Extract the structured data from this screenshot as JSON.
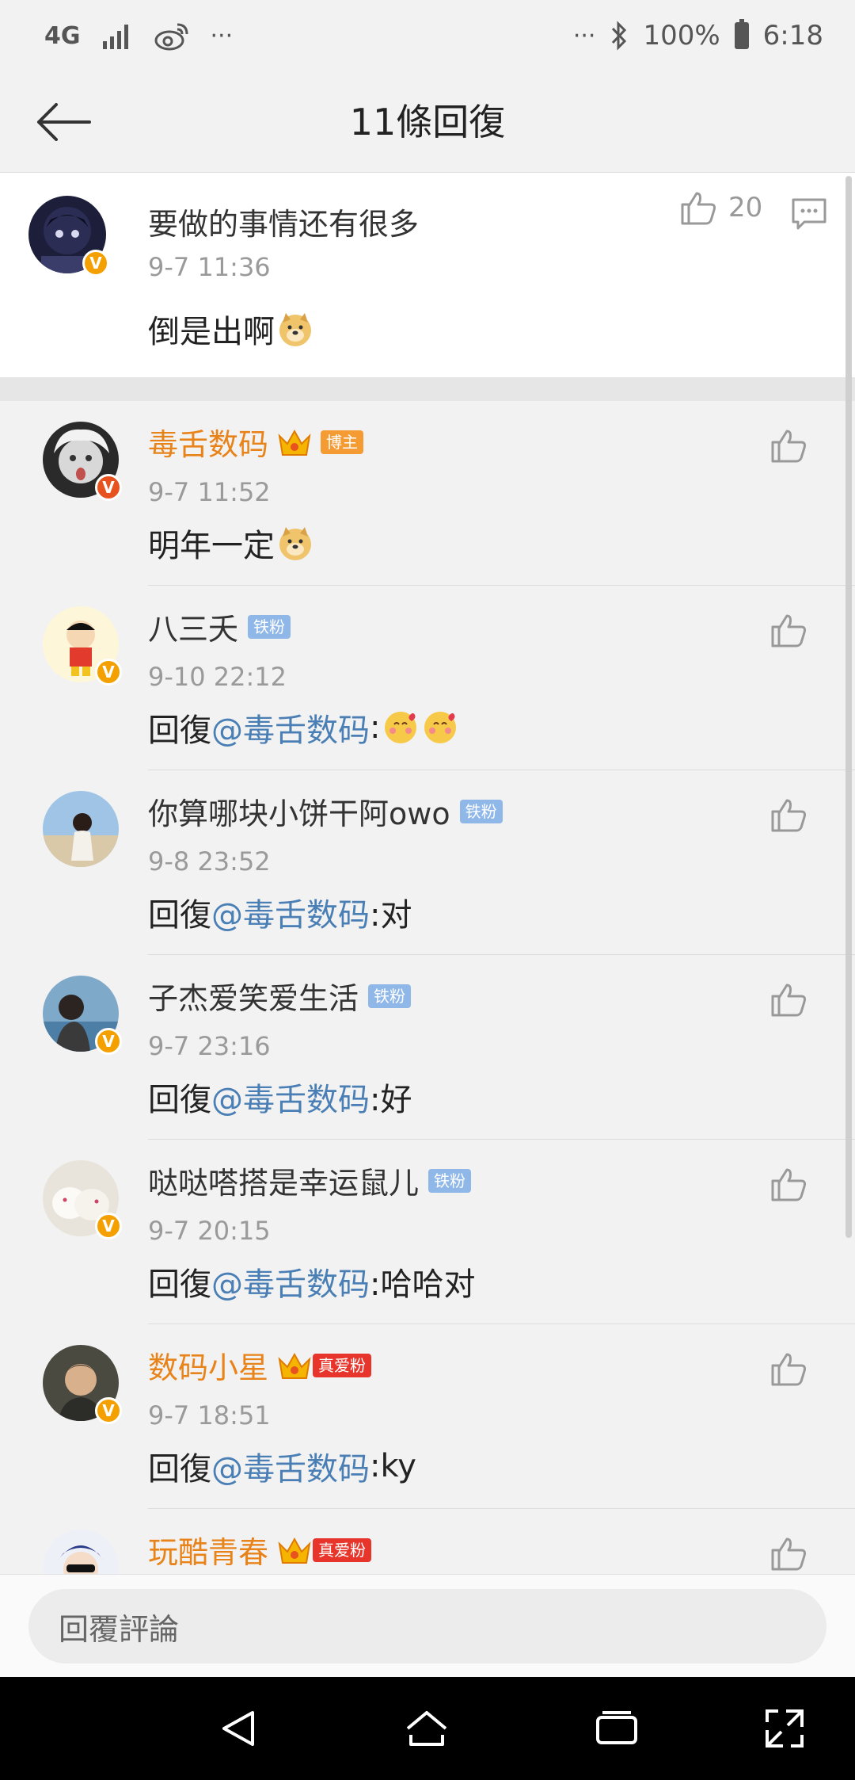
{
  "status_bar": {
    "network": "4G",
    "dots_left": "···",
    "dots_right": "···",
    "battery": "100%",
    "time": "6:18"
  },
  "header": {
    "title": "11條回復"
  },
  "main_comment": {
    "username": "要做的事情还有很多",
    "time": "9-7 11:36",
    "text": "倒是出啊",
    "like_count": "20"
  },
  "replies": [
    {
      "username": "毒舌数码",
      "badge": "博主",
      "time": "9-7 11:52",
      "prefix": "明年一定",
      "mention": "",
      "suffix": ""
    },
    {
      "username": "八三夭",
      "badge": "铁粉",
      "time": "9-10 22:12",
      "prefix": "回復",
      "mention": "@毒舌数码",
      "suffix": ":"
    },
    {
      "username": "你算哪块小饼干阿owo",
      "badge": "铁粉",
      "time": "9-8 23:52",
      "prefix": "回復",
      "mention": "@毒舌数码",
      "suffix": ":对"
    },
    {
      "username": "子杰爱笑爱生活",
      "badge": "铁粉",
      "time": "9-7 23:16",
      "prefix": "回復",
      "mention": "@毒舌数码",
      "suffix": ":好"
    },
    {
      "username": "哒哒嗒搭是幸运鼠儿",
      "badge": "铁粉",
      "time": "9-7 20:15",
      "prefix": "回復",
      "mention": "@毒舌数码",
      "suffix": ":哈哈对"
    },
    {
      "username": "数码小星",
      "badge": "真爱粉",
      "time": "9-7 18:51",
      "prefix": "回復",
      "mention": "@毒舌数码",
      "suffix": ":ky"
    },
    {
      "username": "玩酷青春",
      "badge": "真爱粉",
      "time": "",
      "prefix": "",
      "mention": "",
      "suffix": ""
    }
  ],
  "input": {
    "placeholder": "回覆評論"
  },
  "icons": {
    "back": "arrow-left-icon",
    "like": "thumbs-up-icon",
    "comment": "comment-icon",
    "nav_back": "triangle-back-icon",
    "nav_home": "home-icon",
    "nav_recent": "recent-apps-icon",
    "nav_expand": "expand-icon"
  },
  "colors": {
    "vip_name": "#e8831a",
    "mention": "#4a7fb5",
    "badge_blue": "#8fb7e8",
    "badge_orange": "#f59b34",
    "badge_red": "#e8352b"
  }
}
